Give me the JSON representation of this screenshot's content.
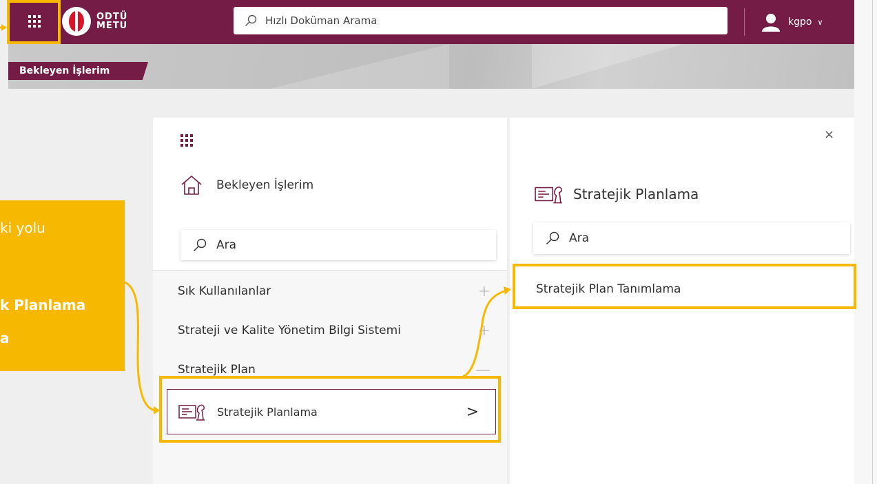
{
  "header": {
    "logo_line1": "ODTÜ",
    "logo_line2": "METU",
    "search_placeholder": "Hızlı Doküman Arama",
    "user_name": "kgpo",
    "user_chevron": "∨"
  },
  "banner": {
    "tab_label": "Bekleyen İşlerim"
  },
  "tooltip": {
    "line1": "ki yolu",
    "line2": "k Planlama",
    "line3": "a"
  },
  "left_panel": {
    "home_label": "Bekleyen İşlerim",
    "search_placeholder": "Ara",
    "menu": [
      {
        "label": "Sık Kullanılanlar",
        "sign": "+"
      },
      {
        "label": "Strateji ve Kalite Yönetim Bilgi Sistemi",
        "sign": "+"
      },
      {
        "label": "Stratejik Plan",
        "sign": "—"
      }
    ],
    "sub_item": {
      "label": "Stratejik Planlama",
      "chevron": ">"
    }
  },
  "right_panel": {
    "close": "×",
    "title": "Stratejik Planlama",
    "search_placeholder": "Ara",
    "items": [
      {
        "label": "Stratejik Plan Tanımlama"
      }
    ]
  },
  "colors": {
    "brand": "#741c46",
    "highlight": "#f6b800",
    "logo_red": "#d7162b"
  }
}
